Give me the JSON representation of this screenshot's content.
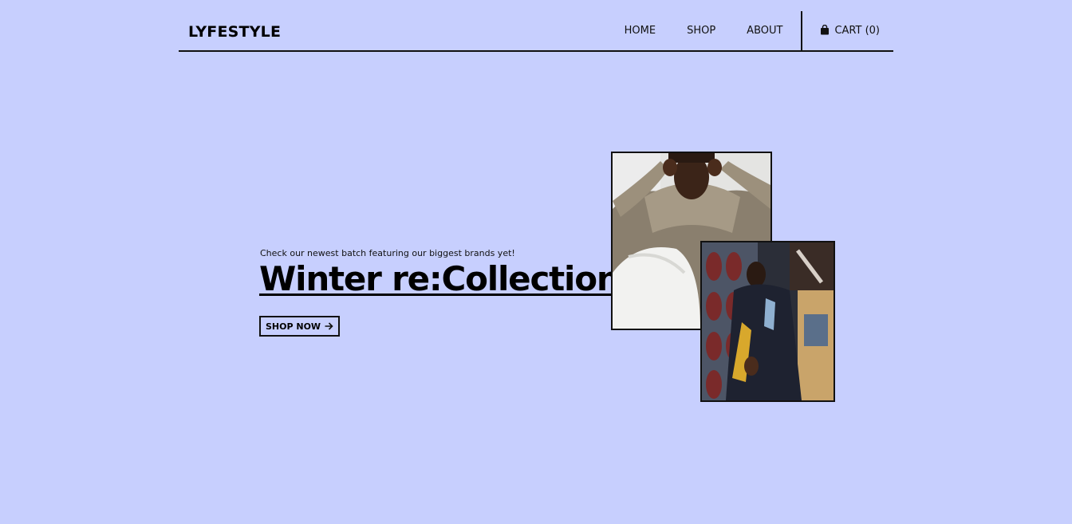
{
  "header": {
    "logo": "LYFESTYLE",
    "nav": [
      {
        "label": "HOME"
      },
      {
        "label": "SHOP"
      },
      {
        "label": "ABOUT"
      }
    ],
    "cart": {
      "label": "CART (0)",
      "icon": "shopping-bag-icon"
    }
  },
  "hero": {
    "subtitle": "Check our newest batch featuring our biggest brands yet!",
    "title": "Winter re:Collection",
    "cta": {
      "label": "SHOP NOW",
      "icon": "arrow-right-icon"
    },
    "images": [
      {
        "name": "hero-photo-hoodie",
        "description_icon": "photo"
      },
      {
        "name": "hero-photo-street",
        "description_icon": "photo"
      }
    ]
  },
  "colors": {
    "background": "#c7cffe",
    "text": "#000000",
    "border": "#111111"
  }
}
